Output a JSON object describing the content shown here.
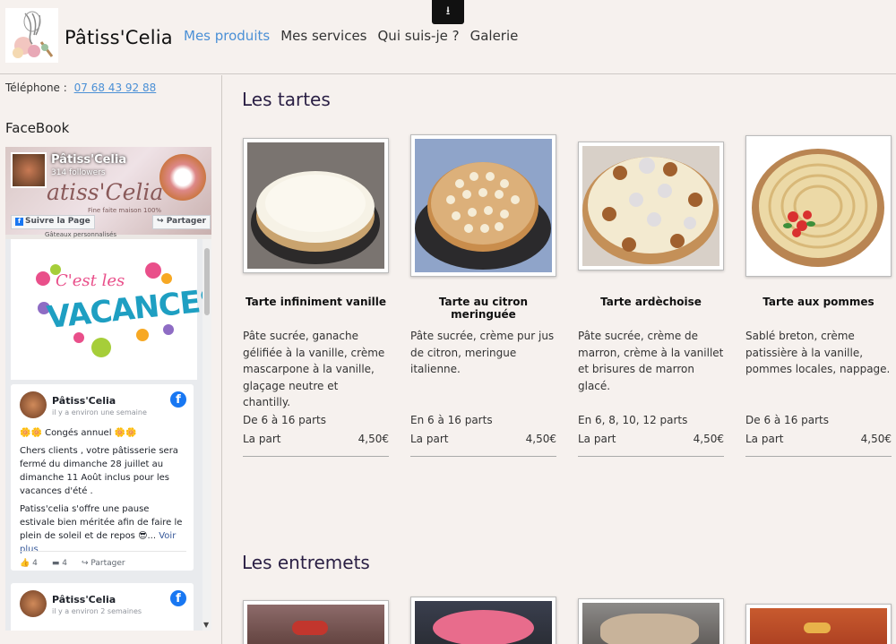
{
  "header": {
    "brand": "Pâtiss'Celia",
    "nav": [
      "Mes produits",
      "Mes services",
      "Qui suis-je ?",
      "Galerie"
    ],
    "download_glyph": "⭳"
  },
  "sidebar": {
    "phone_label": "Téléphone :",
    "phone_number": "07 68 43 92 88",
    "facebook_title": "FaceBook",
    "fb": {
      "page_name": "Pâtiss'Celia",
      "followers": "314 followers",
      "cover_script": "atiss'Celia",
      "cover_tagline": "Fine faite maison 100%",
      "cover_sub": "Gâteaux personnalisés",
      "follow_label": "Suivre la Page",
      "share_label": "Partager",
      "banner_line1": "C'est les",
      "banner_line2": "VACANCES",
      "posts": [
        {
          "author": "Pâtiss'Celia",
          "time": "il y a environ une semaine",
          "title": "🌼🌼 Congés annuel 🌼🌼",
          "para1": "Chers clients , votre pâtisserie sera fermé du dimanche 28 juillet au dimanche 11 Août inclus pour les vacances d'été .",
          "para2": "Patiss'celia s'offre une pause estivale bien méritée afin de faire le plein de soleil et de repos 😎...",
          "more": "Voir plus",
          "likes": "4",
          "comments": "4",
          "share": "Partager"
        },
        {
          "author": "Pâtiss'Celia",
          "time": "il y a environ 2 semaines"
        }
      ]
    }
  },
  "sections": [
    {
      "title": "Les tartes",
      "products": [
        {
          "name": "Tarte infiniment vanille",
          "description": "Pâte sucrée, ganache gélifiée à la vanille, crème mascarpone à la vanille, glaçage neutre et chantilly.",
          "portions": "De 6 à 16 parts",
          "unit": "La part",
          "price": "4,50€"
        },
        {
          "name": "Tarte au citron meringuée",
          "description": "Pâte sucrée, crème pur jus de citron, meringue italienne.",
          "portions": "En 6 à 16 parts",
          "unit": "La part",
          "price": "4,50€"
        },
        {
          "name": "Tarte ardèchoise",
          "description": "Pâte sucrée, crème de marron, crème à la vanillet et brisures de marron glacé.",
          "portions": "En 6, 8, 10, 12 parts",
          "unit": "La part",
          "price": "4,50€"
        },
        {
          "name": "Tarte aux pommes",
          "description": "Sablé breton, crème patissière à la vanille, pommes locales, nappage.",
          "portions": "De 6 à 16 parts",
          "unit": "La part",
          "price": "4,50€"
        }
      ]
    },
    {
      "title": "Les entremets"
    }
  ]
}
